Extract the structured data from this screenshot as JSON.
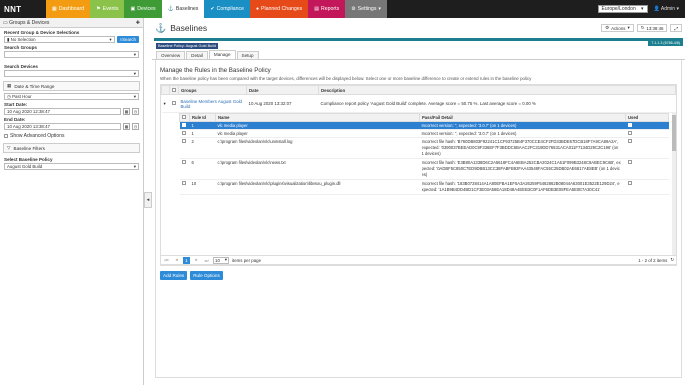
{
  "topbar": {
    "logo": "NNT",
    "tabs": [
      {
        "label": "Dashboard",
        "color": "#f39c12"
      },
      {
        "label": "Events",
        "color": "#8bc34a"
      },
      {
        "label": "Devices",
        "color": "#3f9b35"
      },
      {
        "label": "Baselines",
        "color": "#1e1e1e"
      },
      {
        "label": "Compliance",
        "color": "#1a8fc4"
      },
      {
        "label": "Planned Changes",
        "color": "#e64a19"
      },
      {
        "label": "Reports",
        "color": "#c2185b"
      },
      {
        "label": "Settings",
        "color": "#777777"
      }
    ],
    "timezone": "Europe/London",
    "admin": "Admin"
  },
  "sidebar": {
    "header": "Groups & Devices",
    "recent_label": "Recent Group & Device Selections",
    "recent_value": "No Selection",
    "search_button": "Search",
    "search_groups_label": "Search Groups",
    "search_devices_label": "Search Devices",
    "date_section": "Date & Time Range",
    "range_value": "Past Hour",
    "start_label": "Start Date:",
    "start_value": "10 Aug 2020 12:38:47",
    "end_label": "End Date:",
    "end_value": "10 Aug 2020 13:38:47",
    "advanced": "Show Advanced Options",
    "filters_section": "Baseline Filters",
    "select_baseline_label": "Select Baseline Policy",
    "baseline_value": "August Gold Build"
  },
  "main": {
    "title": "Baselines",
    "actions": "Actions",
    "time": "13:38:46",
    "version": "7.1.1.3 (6786-4/8)",
    "badge": "Baseline Policy: August Gold Build",
    "tabs": [
      "Overview",
      "Detail",
      "Manage",
      "Setup"
    ],
    "heading": "Manage the Rules in the Baseline Policy",
    "description": "When the baseline policy has been compared with the target devices, differences will be displayed below. Select one or more baseline difference to create or extend rules in the baseline policy",
    "columns": [
      "Groups",
      "Date",
      "Description"
    ],
    "group": {
      "name": "Baseline Members August Gold Build",
      "date": "10 Aug 2020 13:32:07",
      "description": "Compliance report policy 'August Gold Build' complete. Average score = 50.75 %. Last average score = 0.00 %"
    },
    "inner_columns": [
      "Rule Id",
      "Name",
      "Pass/Fail Detail",
      "Used"
    ],
    "rows": [
      {
        "id": "1",
        "name": "vlc media player",
        "detail": "Incorrect version: '', expected: '3.0.7' (on 1 devices)",
        "selected": true
      },
      {
        "id": "1",
        "name": "vlc media player",
        "detail": "Incorrect version: '', expected: '3.0.7' (on 1 devices)",
        "selected": false
      },
      {
        "id": "2",
        "name": "c:\\program files\\videolan\\vlc\\uninstall.log",
        "detail": "Incorrect file hash: 'B760DB803F92241C1CF93725B4F370CCE4CF2FD33BDE67DCB18F7A9CA89A2A', expected: '0390037BEEAD0C9F336EF7F3BDDC6BAAC2FC319DD76531ACA011F7134D29C2C196' (on 1 devices)",
        "selected": false
      },
      {
        "id": "6",
        "name": "c:\\program files\\videolan\\vlc\\news.txt",
        "detail": "Incorrect file hash: 'E3B80A1338D6C2A5616FC4A6EBA252CBA2024C1A51F099B3248C8ABEC9C6B', expected: '0ADBF5C850C7ED9DBB13CC38FABFB92FAA43548FAC55C25DB02AE6817AE8EB' (on 1 devices)",
        "selected": false
      },
      {
        "id": "10",
        "name": "c:\\program files\\videolan\\vlc\\plugins\\visualization\\libvsxu_plugin.dll",
        "detail": "Incorrect file hash: '183B0728414A1A80EFBA1EF5A3A26259F5462862B08044A63001E3522E129D24', expected: '1A1B9B4DD4BD1CF3E03A56EA18D48A4EEB3C0F1AF6DB3E08FEA5E0E7A30C41'",
        "selected": false
      }
    ],
    "page": "1",
    "page_size": "10",
    "items_per_page": "items per page",
    "range": "1 - 2 of 2 items",
    "add_rules": "Add Rules",
    "rule_options": "Rule Options"
  }
}
